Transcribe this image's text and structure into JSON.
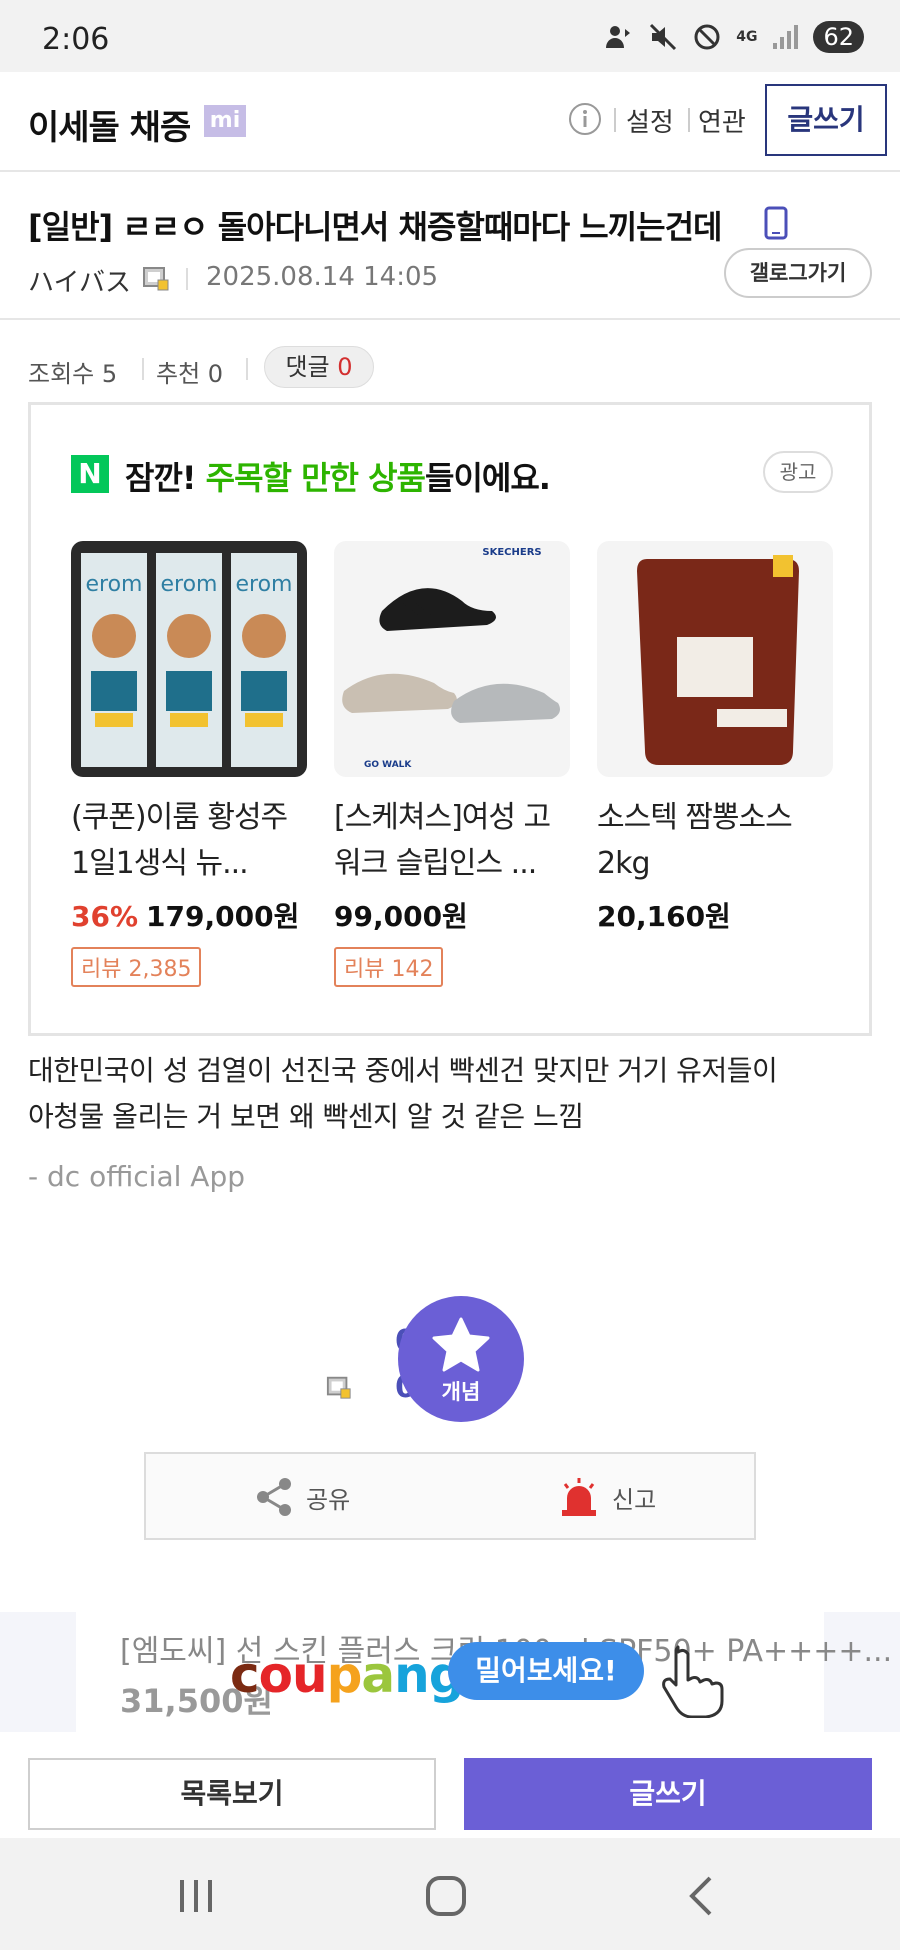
{
  "status_bar": {
    "time": "2:06",
    "network": "4G",
    "battery": "62"
  },
  "header": {
    "gallery_title": "이세돌 채증",
    "gallery_badge": "mi",
    "settings_label": "설정",
    "related_label": "연관",
    "write_label": "글쓰기"
  },
  "post": {
    "title": "[일반] ㄹㄹㅇ 돌아다니면서 채증할때마다 느끼는건데",
    "author": "ハイバス",
    "date": "2025.08.14 14:05",
    "gallery_go_label": "갤로그가기",
    "stats": {
      "views_label": "조회수 5",
      "recommend_label": "추천 0",
      "comment_label": "댓글",
      "comment_count": "0"
    },
    "body_line1": "대한민국이 성 검열이 선진국 중에서 빡센건 맞지만 거기 유저들이",
    "body_line2": "아청물 올리는 거 보면 왜 빡센지 알 것 같은 느낌",
    "app_signature": "- dc official App"
  },
  "ad_box": {
    "heading_prefix": "잠깐! ",
    "heading_highlight": "주목할 만한 상품",
    "heading_suffix": "들이에요.",
    "ad_label": "광고",
    "products": [
      {
        "name": "(쿠폰)이룸 황성주 1일1생식 뉴...",
        "discount": "36%",
        "price": "179,000원",
        "review": "리뷰 2,385"
      },
      {
        "name": "[스케쳐스]여성 고워크 슬립인스 ...",
        "discount": "",
        "price": "99,000원",
        "review": "리뷰 142"
      },
      {
        "name": "소스텍 짬뽕소스 2kg",
        "discount": "",
        "price": "20,160원",
        "review": ""
      }
    ]
  },
  "recommend": {
    "count_top": "0",
    "count_bottom": "0",
    "button_label": "개념"
  },
  "actions": {
    "share_label": "공유",
    "report_label": "신고"
  },
  "banner": {
    "title": "[엠도씨] 선 스킨 플러스 크림 100ml SPF50+ PA++++...",
    "price": "31,500원",
    "brand": "coupang",
    "cta": "밀어보세요!"
  },
  "bottom": {
    "list_label": "목록보기",
    "write_label": "글쓰기"
  },
  "colors": {
    "accent": "#6b5fd6",
    "header_border": "#29367c",
    "naver_green": "#03c75a",
    "discount_red": "#e0412f"
  }
}
